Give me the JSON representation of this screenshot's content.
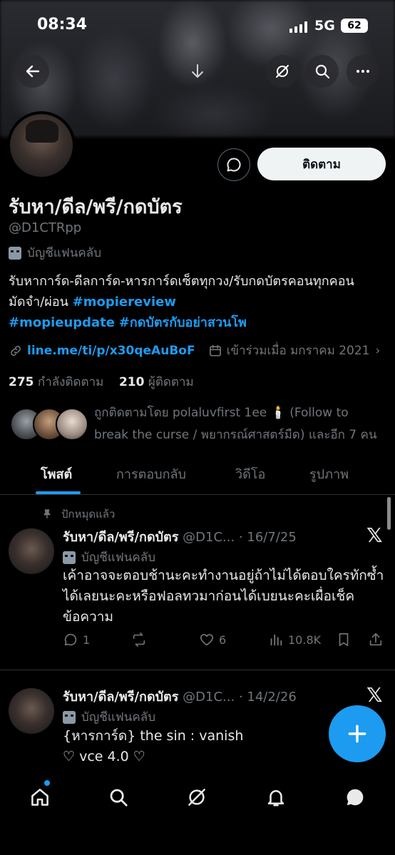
{
  "status_bar": {
    "time": "08:34",
    "network": "5G",
    "battery": "62"
  },
  "profile": {
    "name": "รับหา/ดีล/พรี/กดบัตร",
    "handle": "@D1CTRpp",
    "account_label": "บัญชีแฟนคลับ",
    "follow_label": "ติดตาม",
    "bio_text": "รับหาการ์ด-ดีลการ์ด-หารการ์ดเซ็ตทุกวง/รับกดบัตรคอนทุกคอน มัดจำ/ผ่อน",
    "bio_tags": [
      "#mopiereview",
      "#mopieupdate",
      "#กดบัตรกับอย่าสวนโพ"
    ],
    "link": "line.me/ti/p/x30qeAuBoF",
    "joined": "เข้าร่วมเมื่อ มกราคม 2021",
    "following_count": "275",
    "following_label": "กำลังติดตาม",
    "followers_count": "210",
    "followers_label": "ผู้ติดตาม",
    "followed_by": "ถูกติดตามโดย polaluvfirst 1ee 🕯️ (Follow to break the curse / พยากรณ์ศาสตร์มืด) และอีก 7 คน"
  },
  "tabs": [
    {
      "label": "โพสต์",
      "active": true
    },
    {
      "label": "การตอบกลับ",
      "active": false
    },
    {
      "label": "วิดีโอ",
      "active": false
    },
    {
      "label": "รูปภาพ",
      "active": false
    }
  ],
  "posts": [
    {
      "pinned_label": "ปักหมุดแล้ว",
      "name": "รับหา/ดีล/พรี/กดบัตร",
      "handle": "@D1C...",
      "date": "16/7/25",
      "label": "บัญชีแฟนคลับ",
      "text": "เค้าอาจจะตอบช้านะคะทำงานอยู่ถ้าไม่ได้ตอบใครทักซ้ำได้เลยนะคะหรือฟอลทวมาก่อนได้เบยนะคะเผื่อเช็คข้อความ",
      "replies": "1",
      "retweets": "",
      "likes": "6",
      "views": "10.8K"
    },
    {
      "name": "รับหา/ดีล/พรี/กดบัตร",
      "handle": "@D1C...",
      "date": "14/2/26",
      "label": "บัญชีแฟนคลับ",
      "text_line1": "{หารการ์ด} the sin : vanish",
      "text_line2": "♡ vce 4.0 ♡"
    }
  ],
  "icons": {
    "back": "arrow-left-icon",
    "download": "arrow-down-icon",
    "grok": "grok-icon",
    "search": "search-icon",
    "more": "more-icon",
    "message": "message-icon",
    "link": "link-icon",
    "calendar": "calendar-icon",
    "pin": "pin-icon",
    "x_logo": "x-logo-icon",
    "reply": "reply-icon",
    "retweet": "retweet-icon",
    "like": "heart-icon",
    "views": "views-icon",
    "bookmark": "bookmark-icon",
    "share": "share-icon",
    "compose": "plus-icon",
    "home": "home-icon",
    "explore": "search-icon",
    "notifications": "bell-icon",
    "messages": "chat-icon"
  },
  "colors": {
    "accent": "#1d9bf0",
    "background": "#000000",
    "muted": "#71767b",
    "text": "#e7e9ea"
  }
}
